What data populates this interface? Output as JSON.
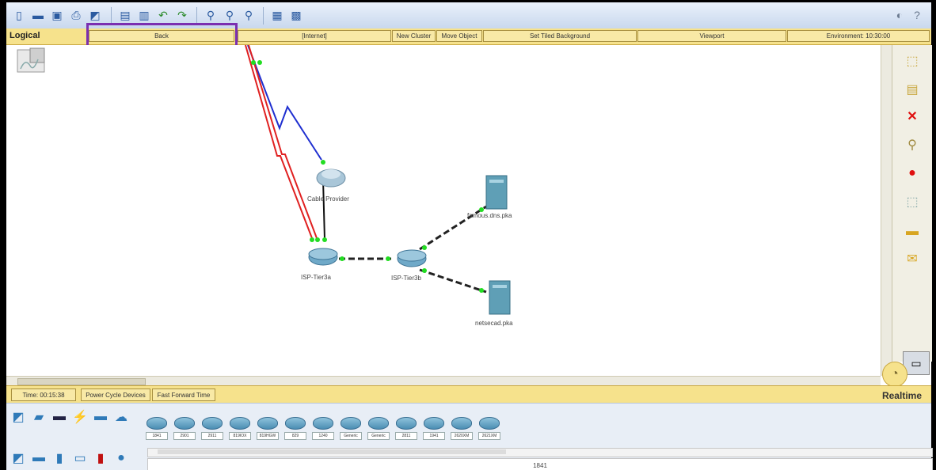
{
  "toolbar": {
    "buttons": [
      "new-icon",
      "open-icon",
      "save-icon",
      "print-icon",
      "wizard-icon",
      "copy-icon",
      "paste-icon",
      "undo-icon",
      "redo-icon",
      "zoom-in-icon",
      "zoom-reset-icon",
      "zoom-out-icon",
      "palette-icon",
      "custom-device-icon"
    ],
    "help_glyphs": [
      "?"
    ]
  },
  "logical_bar": {
    "mode_label": "Logical",
    "back_label": "Back",
    "cluster_label": "[Internet]",
    "new_cluster_label": "New Cluster",
    "move_object_label": "Move Object",
    "tiled_background_label": "Set Tiled Background",
    "viewport_label": "Viewport",
    "environment_label": "Environment: 10:30:00"
  },
  "workspace": {
    "devices": [
      {
        "name": "Cable Provider"
      },
      {
        "name": "famous.dns.pka"
      },
      {
        "name": "ISP-Tier3a"
      },
      {
        "name": "ISP-Tier3b"
      },
      {
        "name": "netsecad.pka"
      }
    ]
  },
  "status_bar": {
    "time_label": "Time: 00:15:38",
    "power_cycle_label": "Power Cycle Devices",
    "fast_forward_label": "Fast Forward Time",
    "realtime_label": "Realtime"
  },
  "device_tray": {
    "models": [
      "1841",
      "2901",
      "2911",
      "819IOX",
      "819HGW",
      "829",
      "1240",
      "Generic",
      "Generic",
      "2811",
      "1941",
      "2620XM",
      "2621XM"
    ],
    "selected_model": "1841"
  },
  "colors": {
    "toolbar_bg": "#c9d8ee",
    "yellow_bar": "#f6e28c",
    "highlight": "#7b2fb0",
    "serial_link": "#1f2fd0",
    "ethernet_red": "#e02020",
    "link_ok": "#22dd22"
  }
}
